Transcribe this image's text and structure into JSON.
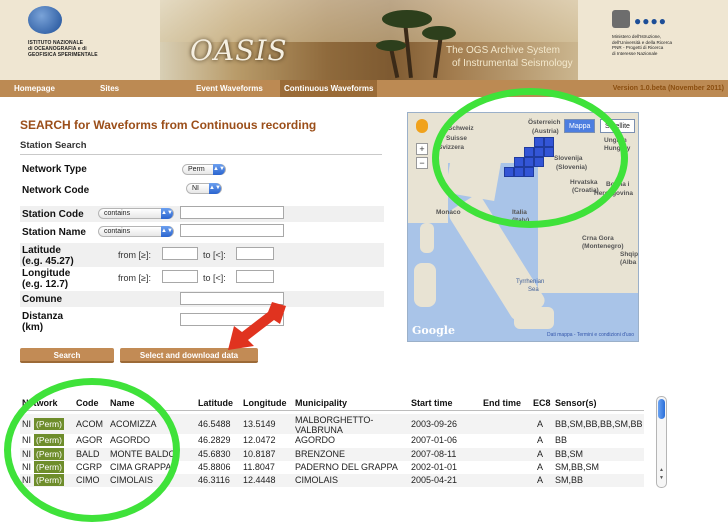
{
  "header": {
    "left_logo_text": [
      "ISTITUTO NAZIONALE",
      "di OCEANOGRAFIA e di",
      "GEOFISICA SPERIMENTALE"
    ],
    "app_title": "OASIS",
    "subtitle_line1": "The OGS Archive System",
    "subtitle_line2": "of Instrumental Seismology",
    "right_logo_text": [
      "Ministero dell'Istruzione,",
      "dell'Università e della Ricerca",
      "PNR - Progetti di Ricerca",
      "di Interesse Nazionale"
    ]
  },
  "nav": {
    "items": [
      "Homepage",
      "Sites",
      "Event Waveforms",
      "Continuous Waveforms"
    ],
    "active": "Continuous Waveforms",
    "version": "Version 1.0.beta (November 2011)"
  },
  "search": {
    "title": "SEARCH for Waveforms from Continuous recording",
    "section": "Station Search",
    "network_type_label": "Network Type",
    "network_type_value": "Perm",
    "network_code_label": "Network Code",
    "network_code_value": "NI",
    "station_code_label": "Station Code",
    "station_code_mode": "contains",
    "station_name_label": "Station Name",
    "station_name_mode": "contains",
    "latitude_label": "Latitude",
    "latitude_hint": "(e.g. 45.27)",
    "longitude_label": "Longitude",
    "longitude_hint": "(e.g. 12.7)",
    "from_label": "from [≥]:",
    "to_label": "to [<]:",
    "comune_label": "Comune",
    "distanza_label": "Distanza",
    "distanza_unit": "(km)",
    "search_button": "Search",
    "download_button": "Select and download data"
  },
  "map": {
    "mappa_button": "Mappa",
    "satellite_button": "Satellite",
    "labels": {
      "schweiz": "Schweiz",
      "suisse": "Suisse",
      "svizzera": "Svizzera",
      "osterreich": "Österreich",
      "austria": "(Austria)",
      "ungarn": "Ungarn",
      "hungary": "Hungary",
      "slovenija": "Slovenija",
      "slovenia": "(Slovenia)",
      "hrvatska": "Hrvatska",
      "croatia": "(Croatia)",
      "bosna": "Bosna i",
      "hercegovina": "Hercegovina",
      "italia": "Italia",
      "italy": "(Italy)",
      "monaco": "Monaco",
      "crna_gora": "Crna Gora",
      "montenegro": "(Montenegro)",
      "shqip": "Shqip",
      "alba": "(Alba",
      "tyrrhenian": "Tyrrhenian",
      "sea": "Sea"
    },
    "google": "Google",
    "terms": "Dati mappa - Termini e condizioni d'uso"
  },
  "table": {
    "headers": [
      "Network",
      "Code",
      "Name",
      "Latitude",
      "Longitude",
      "Municipality",
      "Start time",
      "End time",
      "EC8",
      "Sensor(s)"
    ],
    "rows": [
      {
        "net": "NI",
        "type": "(Perm)",
        "code": "ACOM",
        "name": "ACOMIZZA",
        "lat": "46.5488",
        "lon": "13.5149",
        "muni": "MALBORGHETTO-VALBRUNA",
        "start": "2003-09-26",
        "end": "",
        "ec8": "A",
        "sensors": "BB,SM,BB,BB,SM,BB"
      },
      {
        "net": "NI",
        "type": "(Perm)",
        "code": "AGOR",
        "name": "AGORDO",
        "lat": "46.2829",
        "lon": "12.0472",
        "muni": "AGORDO",
        "start": "2007-01-06",
        "end": "",
        "ec8": "A",
        "sensors": "BB"
      },
      {
        "net": "NI",
        "type": "(Perm)",
        "code": "BALD",
        "name": "MONTE BALDO",
        "lat": "45.6830",
        "lon": "10.8187",
        "muni": "BRENZONE",
        "start": "2007-08-11",
        "end": "",
        "ec8": "A",
        "sensors": "BB,SM"
      },
      {
        "net": "NI",
        "type": "(Perm)",
        "code": "CGRP",
        "name": "CIMA GRAPPA",
        "lat": "45.8806",
        "lon": "11.8047",
        "muni": "PADERNO DEL GRAPPA",
        "start": "2002-01-01",
        "end": "",
        "ec8": "A",
        "sensors": "SM,BB,SM"
      },
      {
        "net": "NI",
        "type": "(Perm)",
        "code": "CIMO",
        "name": "CIMOLAIS",
        "lat": "46.3116",
        "lon": "12.4448",
        "muni": "CIMOLAIS",
        "start": "2005-04-21",
        "end": "",
        "ec8": "A",
        "sensors": "SM,BB"
      }
    ]
  },
  "colors": {
    "nav_bar": "#bc8a53",
    "title_brown": "#9b4e19",
    "perm_badge": "#6e8d2b",
    "annotation_green": "#3fe23a",
    "annotation_red": "#e0331f",
    "station_blue": "#3355d6"
  }
}
